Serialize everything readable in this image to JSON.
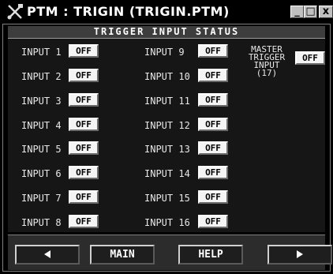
{
  "window": {
    "title": "PTM : TRIGIN (TRIGIN.PTM)",
    "icon": "tools-icon",
    "controls": {
      "minimize": "_",
      "maximize": "□",
      "close": "x"
    }
  },
  "header": {
    "title": "TRIGGER INPUT STATUS"
  },
  "inputs_left": [
    {
      "label": "INPUT 1",
      "state": "OFF"
    },
    {
      "label": "INPUT 2",
      "state": "OFF"
    },
    {
      "label": "INPUT 3",
      "state": "OFF"
    },
    {
      "label": "INPUT 4",
      "state": "OFF"
    },
    {
      "label": "INPUT 5",
      "state": "OFF"
    },
    {
      "label": "INPUT 6",
      "state": "OFF"
    },
    {
      "label": "INPUT 7",
      "state": "OFF"
    },
    {
      "label": "INPUT 8",
      "state": "OFF"
    }
  ],
  "inputs_right": [
    {
      "label": "INPUT 9",
      "state": "OFF"
    },
    {
      "label": "INPUT 10",
      "state": "OFF"
    },
    {
      "label": "INPUT 11",
      "state": "OFF"
    },
    {
      "label": "INPUT 12",
      "state": "OFF"
    },
    {
      "label": "INPUT 13",
      "state": "OFF"
    },
    {
      "label": "INPUT 14",
      "state": "OFF"
    },
    {
      "label": "INPUT 15",
      "state": "OFF"
    },
    {
      "label": "INPUT 16",
      "state": "OFF"
    }
  ],
  "master": {
    "line1": "MASTER",
    "line2": "TRIGGER",
    "line3": "INPUT",
    "line4": "(17)",
    "state": "OFF"
  },
  "nav": {
    "prev_icon": "left-arrow-icon",
    "main_label": "MAIN",
    "help_label": "HELP",
    "next_icon": "right-arrow-icon"
  }
}
